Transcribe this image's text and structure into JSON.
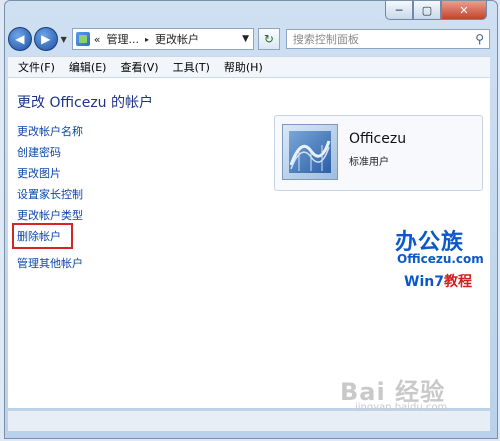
{
  "window": {
    "min_glyph": "─",
    "max_glyph": "▢",
    "close_glyph": "✕"
  },
  "nav": {
    "back_glyph": "◀",
    "forward_glyph": "▶",
    "breadcrumb": {
      "chevrons": "«",
      "segment1": "管理...",
      "arrow": "▸",
      "segment2": "更改帐户"
    },
    "dropdown_glyph": "▼",
    "refresh_glyph": "↻",
    "search_placeholder": "搜索控制面板",
    "search_glyph": "⚲"
  },
  "menu": [
    "文件(F)",
    "编辑(E)",
    "查看(V)",
    "工具(T)",
    "帮助(H)"
  ],
  "main": {
    "title": "更改 Officezu 的帐户",
    "links": [
      "更改帐户名称",
      "创建密码",
      "更改图片",
      "设置家长控制",
      "更改帐户类型",
      "删除帐户",
      "管理其他帐户"
    ]
  },
  "account_card": {
    "name": "Officezu",
    "role": "标准用户"
  },
  "overlay": {
    "logo_main": "办公族",
    "logo_url": "Officezu.com",
    "logo_win7": "Win7",
    "logo_tutorial": "教程",
    "watermark_main": "Bai 经验",
    "watermark_url": "jingyan.baidu.com"
  }
}
